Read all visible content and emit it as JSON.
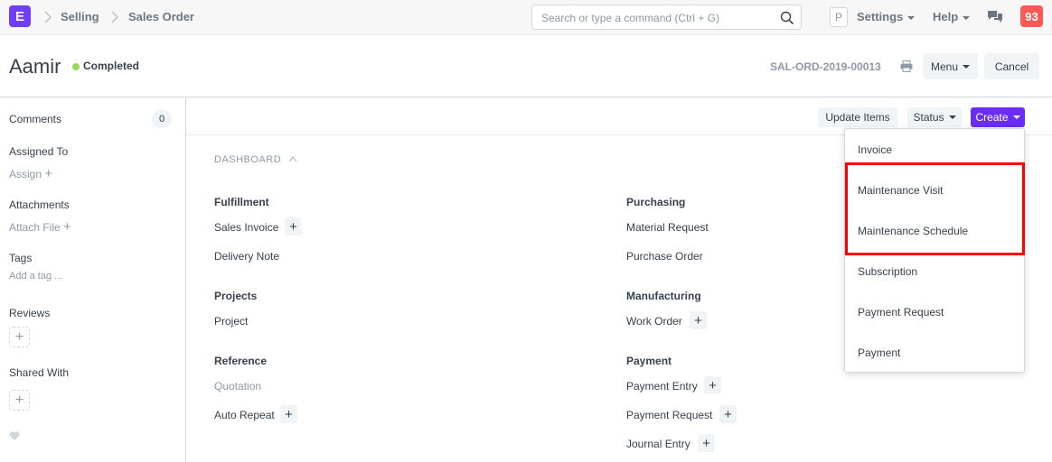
{
  "navbar": {
    "logo_letter": "E",
    "breadcrumbs": [
      "Selling",
      "Sales Order"
    ],
    "search_placeholder": "Search or type a command (Ctrl + G)",
    "user_initial": "P",
    "settings_label": "Settings",
    "help_label": "Help",
    "notification_count": "93"
  },
  "page": {
    "title": "Aamir",
    "status": "Completed",
    "status_color": "#98d85b",
    "doc_name": "SAL-ORD-2019-00013",
    "menu_label": "Menu",
    "cancel_label": "Cancel"
  },
  "sidebar": {
    "comments_label": "Comments",
    "comments_count": "0",
    "assigned_label": "Assigned To",
    "assign_action": "Assign",
    "attachments_label": "Attachments",
    "attach_action": "Attach File",
    "tags_label": "Tags",
    "add_tag": "Add a tag ...",
    "reviews_label": "Reviews",
    "shared_label": "Shared With"
  },
  "toolbar": {
    "update_items": "Update Items",
    "status": "Status",
    "create": "Create"
  },
  "dashboard": {
    "heading": "DASHBOARD",
    "groups": {
      "fulfillment": {
        "title": "Fulfillment",
        "links": [
          "Sales Invoice",
          "Delivery Note"
        ]
      },
      "purchasing": {
        "title": "Purchasing",
        "links": [
          "Material Request",
          "Purchase Order"
        ]
      },
      "projects": {
        "title": "Projects",
        "links": [
          "Project"
        ]
      },
      "manufacturing": {
        "title": "Manufacturing",
        "links": [
          "Work Order"
        ]
      },
      "reference": {
        "title": "Reference",
        "links": [
          "Quotation",
          "Auto Repeat"
        ]
      },
      "payment": {
        "title": "Payment",
        "links": [
          "Payment Entry",
          "Payment Request",
          "Journal Entry"
        ]
      }
    }
  },
  "create_menu": {
    "items": [
      "Invoice",
      "Maintenance Visit",
      "Maintenance Schedule",
      "Subscription",
      "Payment Request",
      "Payment"
    ]
  },
  "colors": {
    "accent": "#6b2cf5",
    "highlight": "#ff0000",
    "badge": "#ff5858"
  }
}
